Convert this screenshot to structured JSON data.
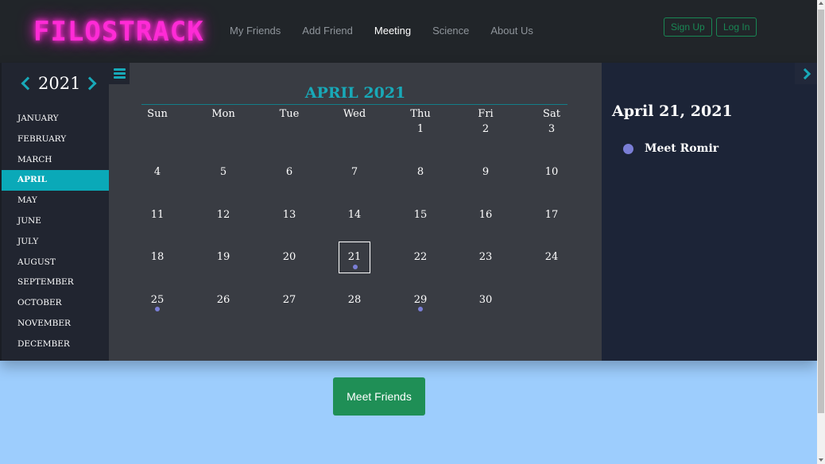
{
  "app": {
    "logo": "FILOSTRACK"
  },
  "nav": {
    "links": [
      "My Friends",
      "Add Friend",
      "Meeting",
      "Science",
      "About Us"
    ],
    "active": "Meeting",
    "sign_up": "Sign Up",
    "log_in": "Log In"
  },
  "calendar": {
    "year": "2021",
    "months": [
      "JANUARY",
      "FEBRUARY",
      "MARCH",
      "APRIL",
      "MAY",
      "JUNE",
      "JULY",
      "AUGUST",
      "SEPTEMBER",
      "OCTOBER",
      "NOVEMBER",
      "DECEMBER"
    ],
    "active_month": "APRIL",
    "title": "APRIL 2021",
    "weekdays": [
      "Sun",
      "Mon",
      "Tue",
      "Wed",
      "Thu",
      "Fri",
      "Sat"
    ],
    "first_weekday_index": 4,
    "days_in_month": 30,
    "selected_day": 21,
    "event_days": [
      21,
      25,
      29
    ]
  },
  "event_panel": {
    "date": "April 21, 2021",
    "events": [
      "Meet Romir"
    ]
  },
  "meet_button": "Meet Friends",
  "colors": {
    "accent": "#18a9b8",
    "event": "#7a7ed6",
    "logo": "#ff2bd6",
    "button": "#1f8f56"
  },
  "icons": {
    "menu": "hamburger-icon",
    "prev_year": "chevron-left-icon",
    "next_year": "chevron-right-icon",
    "panel_toggle": "chevron-right-icon"
  }
}
